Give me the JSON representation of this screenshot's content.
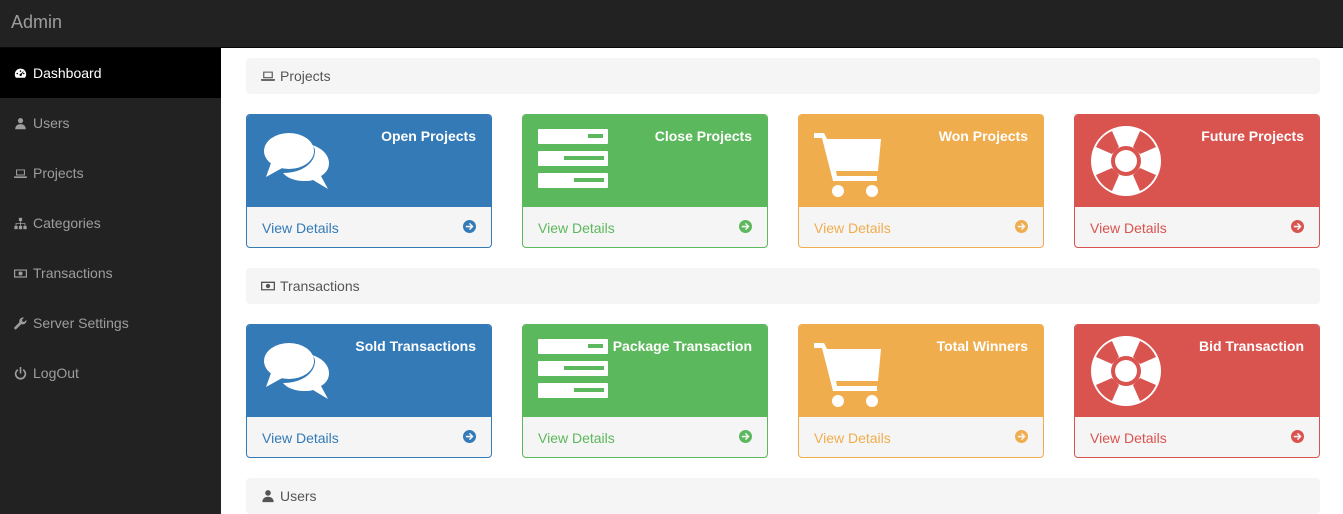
{
  "brand": "Admin",
  "sidebar": {
    "items": [
      {
        "label": "Dashboard",
        "icon": "dashboard-icon",
        "active": true
      },
      {
        "label": "Users",
        "icon": "user-icon"
      },
      {
        "label": "Projects",
        "icon": "laptop-icon"
      },
      {
        "label": "Categories",
        "icon": "sitemap-icon"
      },
      {
        "label": "Transactions",
        "icon": "money-icon"
      },
      {
        "label": "Server Settings",
        "icon": "wrench-icon"
      },
      {
        "label": "LogOut",
        "icon": "power-icon"
      }
    ]
  },
  "sections": {
    "projects": {
      "title": "Projects",
      "icon": "laptop-icon",
      "panels": [
        {
          "title": "Open Projects",
          "link": "View Details",
          "color": "#337ab7",
          "icon": "comments-icon"
        },
        {
          "title": "Close Projects",
          "link": "View Details",
          "color": "#5cb85c",
          "icon": "server-icon"
        },
        {
          "title": "Won Projects",
          "link": "View Details",
          "color": "#f0ad4e",
          "icon": "shopping-cart-icon"
        },
        {
          "title": "Future Projects",
          "link": "View Details",
          "color": "#d9534f",
          "icon": "life-ring-icon"
        }
      ]
    },
    "transactions": {
      "title": "Transactions",
      "icon": "money-icon",
      "panels": [
        {
          "title": "Sold Transactions",
          "link": "View Details",
          "color": "#337ab7",
          "icon": "comments-icon"
        },
        {
          "title": "Package Transaction",
          "link": "View Details",
          "color": "#5cb85c",
          "icon": "server-icon"
        },
        {
          "title": "Total Winners",
          "link": "View Details",
          "color": "#f0ad4e",
          "icon": "shopping-cart-icon"
        },
        {
          "title": "Bid Transaction",
          "link": "View Details",
          "color": "#d9534f",
          "icon": "life-ring-icon"
        }
      ]
    },
    "users": {
      "title": "Users",
      "icon": "user-icon"
    }
  }
}
